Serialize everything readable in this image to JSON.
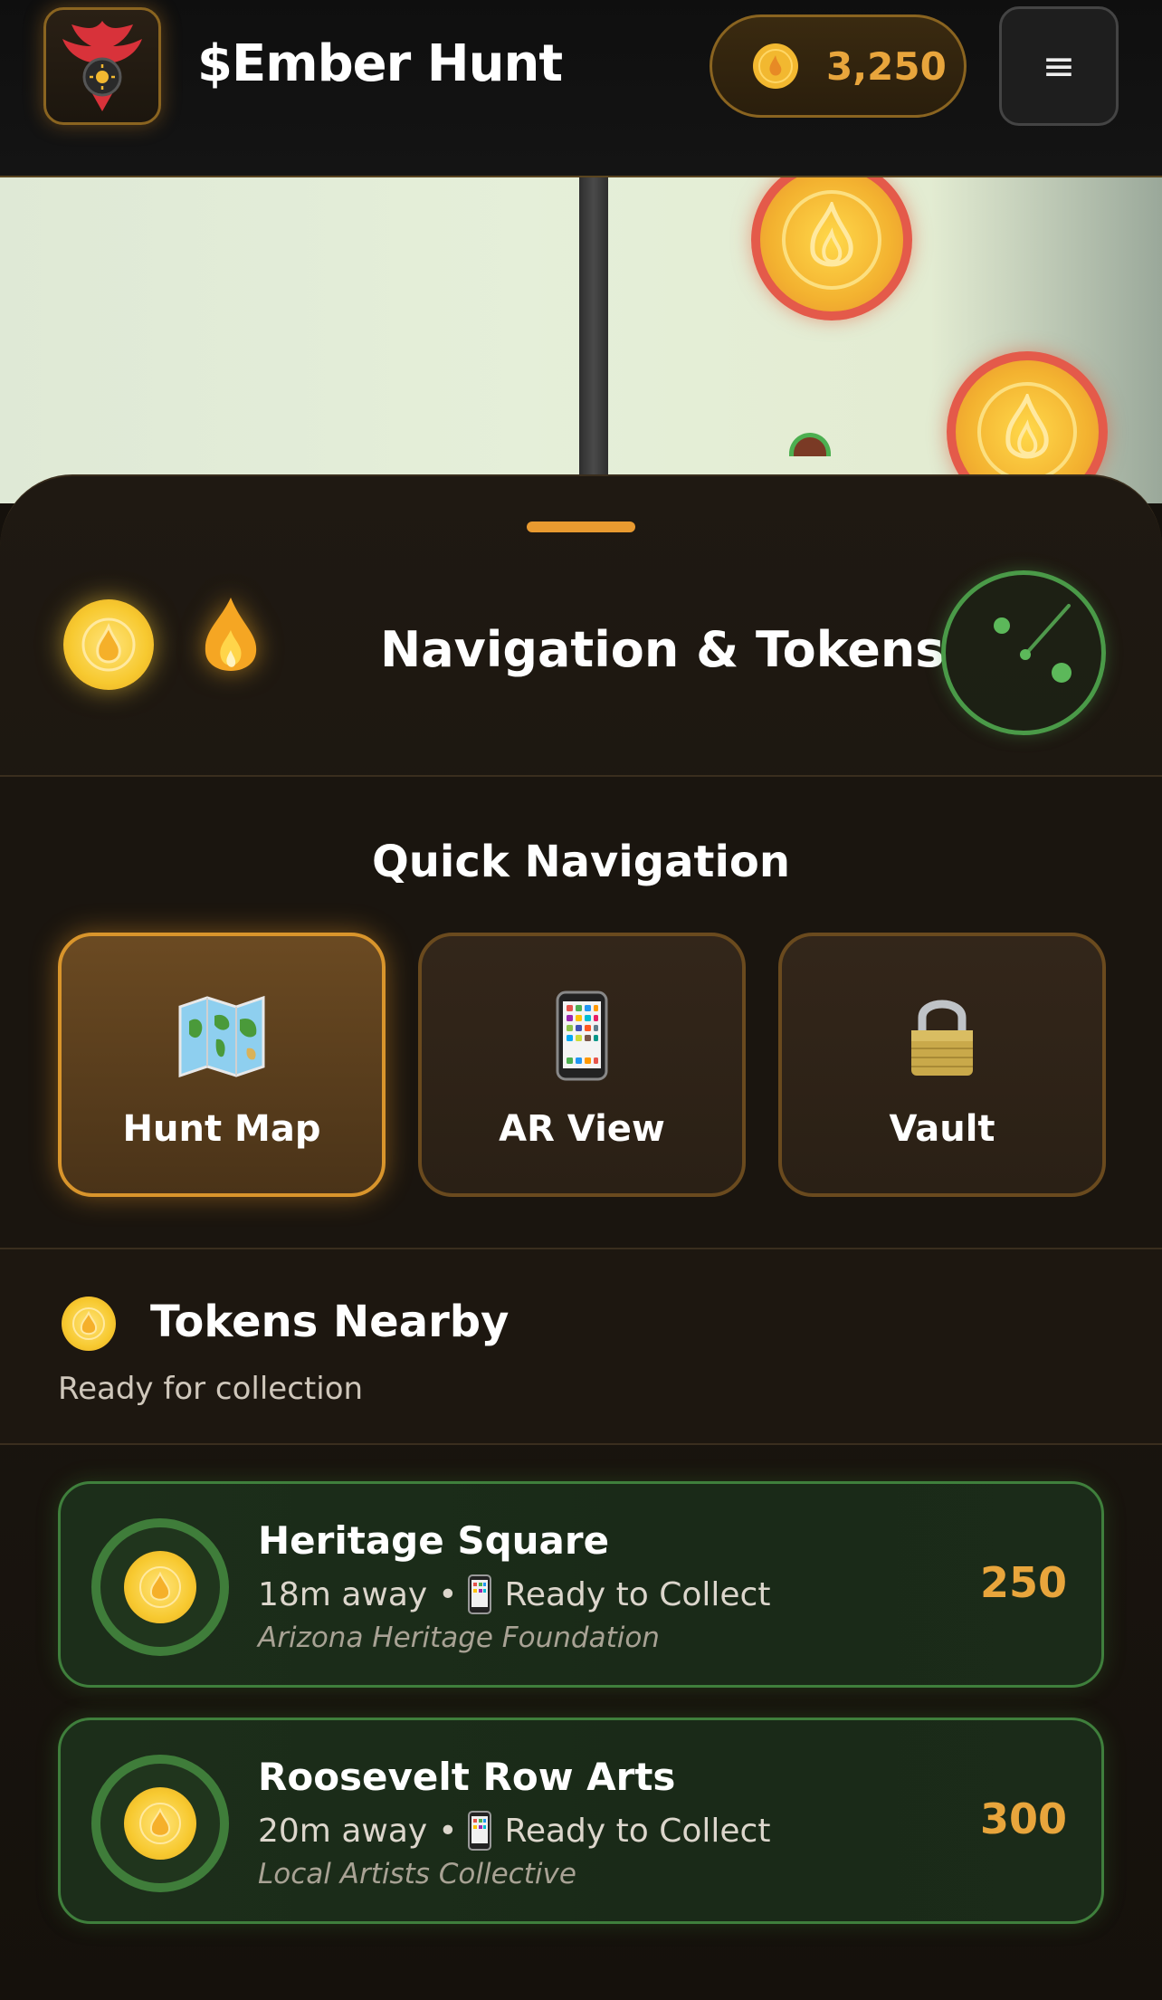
{
  "header": {
    "app_title": "$Ember Hunt",
    "balance": "3,250",
    "menu_label": "≡"
  },
  "sheet": {
    "title": "Navigation & Tokens"
  },
  "quick_nav": {
    "title": "Quick Navigation",
    "items": [
      {
        "label": "Hunt Map",
        "icon": "map-icon",
        "active": true
      },
      {
        "label": "AR View",
        "icon": "phone-icon",
        "active": false
      },
      {
        "label": "Vault",
        "icon": "lock-icon",
        "active": false
      }
    ]
  },
  "nearby": {
    "title": "Tokens Nearby",
    "subtitle": "Ready for collection",
    "tokens": [
      {
        "name": "Heritage Square",
        "distance": "18m away",
        "status": "Ready to Collect",
        "sponsor": "Arizona Heritage Foundation",
        "value": "250"
      },
      {
        "name": "Roosevelt Row Arts",
        "distance": "20m away",
        "status": "Ready to Collect",
        "sponsor": "Local Artists Collective",
        "value": "300"
      }
    ]
  },
  "colors": {
    "accent": "#e8a53c",
    "success": "#4caf50",
    "danger": "#e45a4a"
  }
}
